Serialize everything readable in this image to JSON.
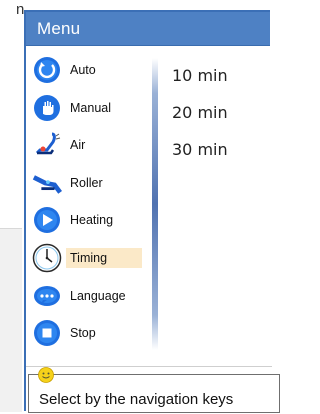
{
  "background": {
    "cut_text": "n"
  },
  "window": {
    "title": "Menu"
  },
  "menu": {
    "items": [
      {
        "label": "Auto",
        "icon": "auto-icon",
        "selected": false
      },
      {
        "label": "Manual",
        "icon": "hand-icon",
        "selected": false
      },
      {
        "label": "Air",
        "icon": "air-chair-icon",
        "selected": false
      },
      {
        "label": "Roller",
        "icon": "roller-chair-icon",
        "selected": false
      },
      {
        "label": "Heating",
        "icon": "heating-icon",
        "selected": false
      },
      {
        "label": "Timing",
        "icon": "clock-icon",
        "selected": true
      },
      {
        "label": "Language",
        "icon": "language-icon",
        "selected": false
      },
      {
        "label": "Stop",
        "icon": "stop-icon",
        "selected": false
      }
    ]
  },
  "options": [
    "10 min",
    "20 min",
    "30 min"
  ],
  "status": {
    "hint": "Select by the navigation keys",
    "icon": "smiley-icon"
  },
  "colors": {
    "titlebar": "#4e81c4",
    "accent": "#1f5fd1",
    "selected_bg": "#fbe9c8"
  }
}
